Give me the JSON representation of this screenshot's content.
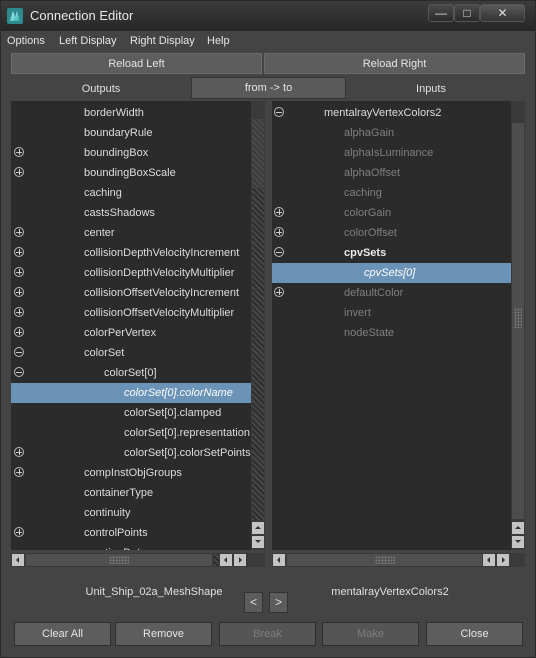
{
  "window": {
    "title": "Connection Editor"
  },
  "menu": [
    "Options",
    "Left Display",
    "Right Display",
    "Help"
  ],
  "reload": {
    "left": "Reload Left",
    "right": "Reload Right"
  },
  "headers": {
    "outputs": "Outputs",
    "direction": "from -> to",
    "inputs": "Inputs"
  },
  "left_list": [
    {
      "label": "borderWidth",
      "expander": "none"
    },
    {
      "label": "boundaryRule",
      "expander": "none"
    },
    {
      "label": "boundingBox",
      "expander": "plus"
    },
    {
      "label": "boundingBoxScale",
      "expander": "plus"
    },
    {
      "label": "caching",
      "expander": "none"
    },
    {
      "label": "castsShadows",
      "expander": "none"
    },
    {
      "label": "center",
      "expander": "plus"
    },
    {
      "label": "collisionDepthVelocityIncrement",
      "expander": "plus"
    },
    {
      "label": "collisionDepthVelocityMultiplier",
      "expander": "plus"
    },
    {
      "label": "collisionOffsetVelocityIncrement",
      "expander": "plus"
    },
    {
      "label": "collisionOffsetVelocityMultiplier",
      "expander": "plus"
    },
    {
      "label": "colorPerVertex",
      "expander": "plus"
    },
    {
      "label": "colorSet",
      "expander": "minus"
    },
    {
      "label": "colorSet[0]",
      "expander": "minus",
      "indent": 1
    },
    {
      "label": "colorSet[0].colorName",
      "expander": "none",
      "indent": 2,
      "selected": true
    },
    {
      "label": "colorSet[0].clamped",
      "expander": "none",
      "indent": 2
    },
    {
      "label": "colorSet[0].representation",
      "expander": "none",
      "indent": 2
    },
    {
      "label": "colorSet[0].colorSetPoints",
      "expander": "plus",
      "indent": 2
    },
    {
      "label": "compInstObjGroups",
      "expander": "plus"
    },
    {
      "label": "containerType",
      "expander": "none"
    },
    {
      "label": "continuity",
      "expander": "none"
    },
    {
      "label": "controlPoints",
      "expander": "plus"
    },
    {
      "label": "creationDate",
      "expander": "none"
    }
  ],
  "right_list": [
    {
      "label": "mentalrayVertexColors2",
      "expander": "minus",
      "indent": 0
    },
    {
      "label": "alphaGain",
      "expander": "none",
      "indent": 1,
      "dim": true
    },
    {
      "label": "alphaIsLuminance",
      "expander": "none",
      "indent": 1,
      "dim": true
    },
    {
      "label": "alphaOffset",
      "expander": "none",
      "indent": 1,
      "dim": true
    },
    {
      "label": "caching",
      "expander": "none",
      "indent": 1,
      "dim": true
    },
    {
      "label": "colorGain",
      "expander": "plus",
      "indent": 1,
      "dim": true
    },
    {
      "label": "colorOffset",
      "expander": "plus",
      "indent": 1,
      "dim": true
    },
    {
      "label": "cpvSets",
      "expander": "minus",
      "indent": 1,
      "bold": true
    },
    {
      "label": "cpvSets[0]",
      "expander": "none",
      "indent": 2,
      "selected": true
    },
    {
      "label": "defaultColor",
      "expander": "plus",
      "indent": 1,
      "dim": true
    },
    {
      "label": "invert",
      "expander": "none",
      "indent": 1,
      "dim": true
    },
    {
      "label": "nodeState",
      "expander": "none",
      "indent": 1,
      "dim": true
    }
  ],
  "nodes": {
    "left": "Unit_Ship_02a_MeshShape",
    "right": "mentalrayVertexColors2"
  },
  "nav": {
    "prev": "<",
    "next": ">"
  },
  "buttons": {
    "clear_all": "Clear All",
    "remove": "Remove",
    "break": "Break",
    "make": "Make",
    "close": "Close"
  },
  "button_states": {
    "break_enabled": false,
    "make_enabled": false
  }
}
